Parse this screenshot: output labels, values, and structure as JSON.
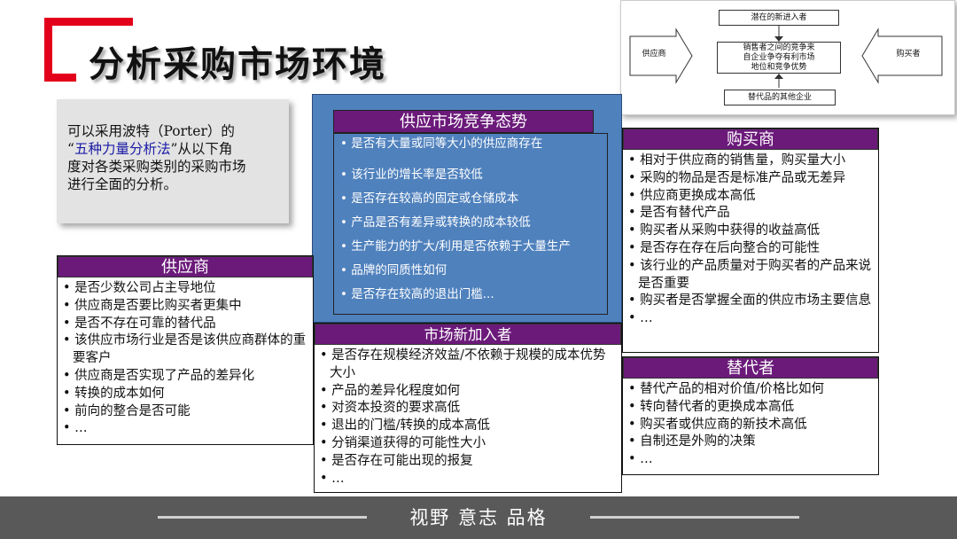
{
  "title": "分析采购市场环境",
  "intro": {
    "line1": "可以采用波特（Porter）的",
    "quote_open": "“",
    "highlight": "五种力量分析法",
    "quote_close": "”从以下角",
    "line3": "度对各类采购类别的采购市场",
    "line4": "进行全面的分析。"
  },
  "diagram": {
    "new_entrants": "潜在的新进入者",
    "supplier": "供应商",
    "rivalry_l1": "销售者之间的竞争来",
    "rivalry_l2": "自企业争夺有利市场",
    "rivalry_l3": "地位和竞争优势",
    "buyer": "购买者",
    "substitutes": "替代品的其他企业"
  },
  "competition": {
    "title": "供应市场竞争态势",
    "items": [
      "是否有大量或同等大小的供应商存在",
      "该行业的增长率是否较低",
      "是否存在较高的固定或仓储成本",
      "产品是否有差异或转换的成本较低",
      "生产能力的扩大/利用是否依赖于大量生产",
      "品牌的同质性如何",
      "是否存在较高的退出门槛..."
    ]
  },
  "buyers": {
    "title": "购买商",
    "items": [
      "相对于供应商的销售量，购买量大小",
      "采购的物品是否是标准产品或无差异",
      "供应商更换成本高低",
      "是否有替代产品",
      "购买者从采购中获得的收益高低",
      "是否存在存在后向整合的可能性",
      "该行业的产品质量对于购买者的产品来说是否重要",
      "购买者是否掌握全面的供应市场主要信息",
      "…"
    ]
  },
  "suppliers": {
    "title": "供应商",
    "items": [
      "是否少数公司占主导地位",
      "供应商是否要比购买者更集中",
      "是否不存在可靠的替代品",
      "该供应市场行业是否是该供应商群体的重要客户",
      "供应商是否实现了产品的差异化",
      "转换的成本如何",
      "前向的整合是否可能",
      "…"
    ]
  },
  "entrants": {
    "title": "市场新加入者",
    "items": [
      "是否存在规模经济效益/不依赖于规模的成本优势大小",
      "产品的差异化程度如何",
      "对资本投资的要求高低",
      "退出的门槛/转换的成本高低",
      "分销渠道获得的可能性大小",
      "是否存在可能出现的报复",
      "…"
    ]
  },
  "substitutes": {
    "title": "替代者",
    "items": [
      "替代产品的相对价值/价格比如何",
      "转向替代者的更换成本高低",
      "购买者或供应商的新技术高低",
      "自制还是外购的决策",
      "…"
    ]
  },
  "footer": "视野 意志 品格",
  "colors": {
    "accent": "#e3001b",
    "panel_header": "#6b1a7a",
    "blue": "#4f81bd",
    "footer": "#595959"
  }
}
